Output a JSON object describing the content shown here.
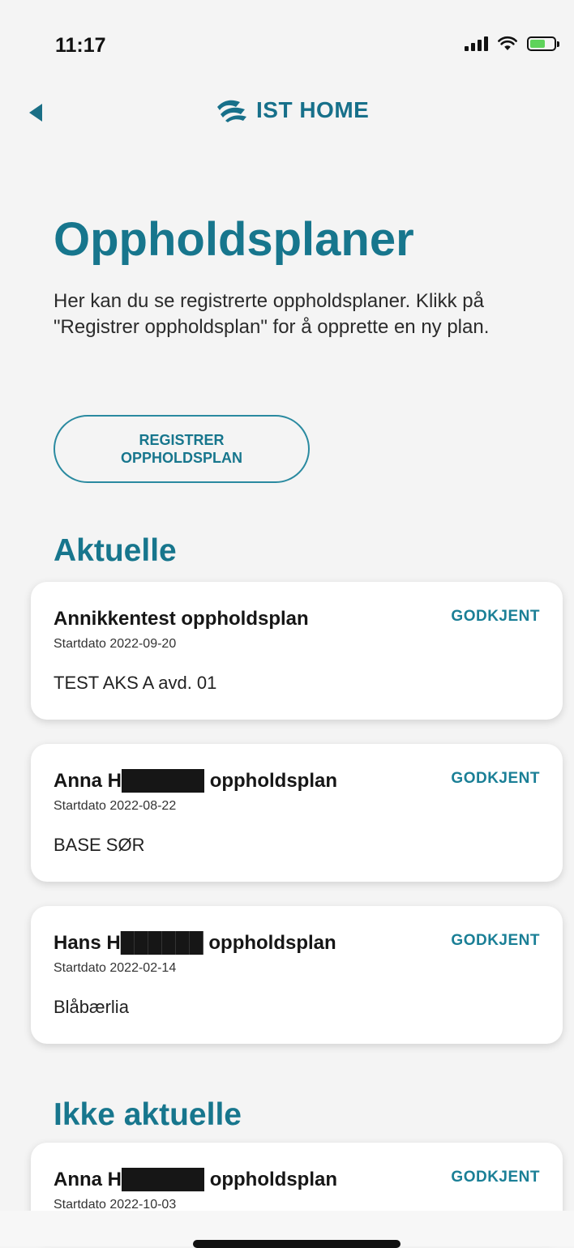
{
  "status_bar": {
    "time": "11:17"
  },
  "header": {
    "back_icon": "back-arrow-icon",
    "logo_text": "IST HOME"
  },
  "page": {
    "title": "Oppholdsplaner",
    "intro": "Her kan du se registrerte oppholdsplaner. Klikk på \"Registrer oppholdsplan\" for å opprette en ny plan.",
    "register_button": "REGISTRER OPPHOLDSPLAN"
  },
  "sections": [
    {
      "title": "Aktuelle",
      "cards": [
        {
          "name": "Annikkentest oppholdsplan",
          "status": "GODKJENT",
          "start": "Startdato 2022-09-20",
          "location": "TEST AKS A avd. 01"
        },
        {
          "name": "Anna H██████ oppholdsplan",
          "status": "GODKJENT",
          "start": "Startdato 2022-08-22",
          "location": "BASE SØR"
        },
        {
          "name": "Hans H██████ oppholdsplan",
          "status": "GODKJENT",
          "start": "Startdato 2022-02-14",
          "location": "Blåbærlia"
        }
      ]
    },
    {
      "title": "Ikke aktuelle",
      "cards": [
        {
          "name": "Anna H██████ oppholdsplan",
          "status": "GODKJENT",
          "start": "Startdato 2022-10-03",
          "location": ""
        }
      ]
    }
  ],
  "colors": {
    "accent": "#17768d",
    "status": "#1a7f96",
    "background": "#f4f4f4"
  }
}
